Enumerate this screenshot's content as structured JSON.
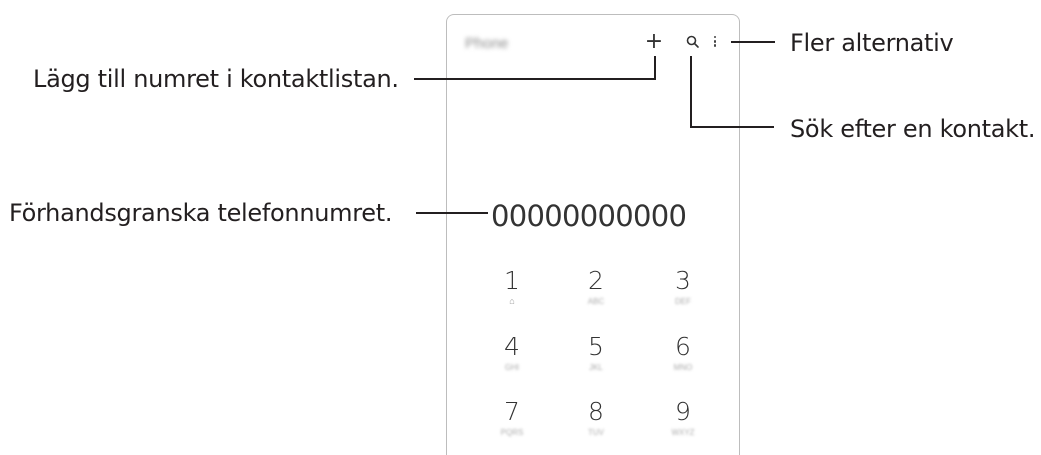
{
  "phone": {
    "app_title": "Phone",
    "plus_icon": "plus-icon",
    "search_icon": "search-icon",
    "more_icon": "more-vertical-icon",
    "number": "00000000000",
    "keys": [
      {
        "digit": "1",
        "sub": "⌂"
      },
      {
        "digit": "2",
        "sub": "ABC"
      },
      {
        "digit": "3",
        "sub": "DEF"
      },
      {
        "digit": "4",
        "sub": "GHI"
      },
      {
        "digit": "5",
        "sub": "JKL"
      },
      {
        "digit": "6",
        "sub": "MNO"
      },
      {
        "digit": "7",
        "sub": "PQRS"
      },
      {
        "digit": "8",
        "sub": "TUV"
      },
      {
        "digit": "9",
        "sub": "WXYZ"
      }
    ]
  },
  "callouts": {
    "more_options": "Fler alternativ",
    "add_contact": "Lägg till numret i kontaktlistan.",
    "search_contact": "Sök efter en kontakt.",
    "preview_number": "Förhandsgranska telefonnumret."
  }
}
